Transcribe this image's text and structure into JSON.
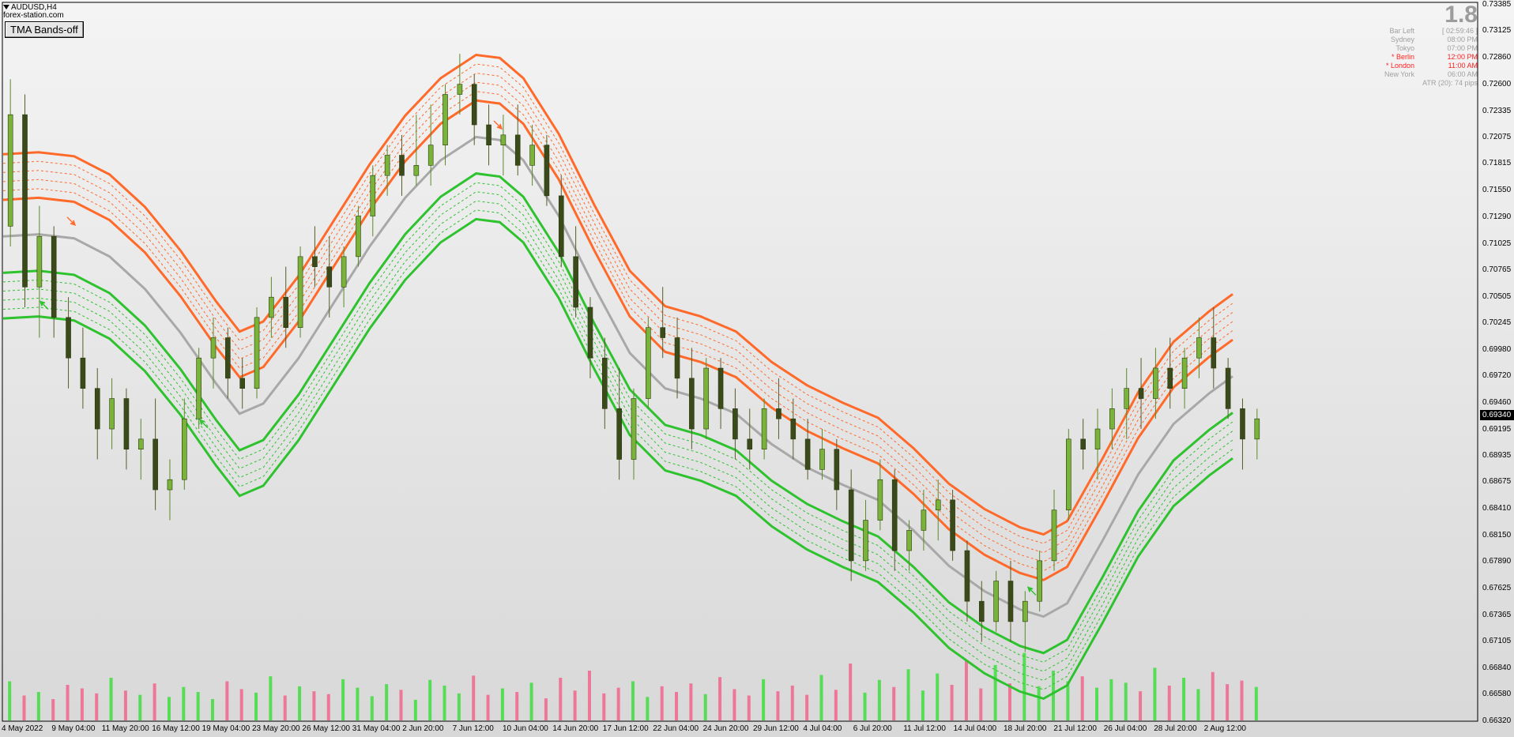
{
  "header": {
    "symbol": "AUDUSD,H4",
    "broker": "forex-station.com",
    "tma_button": "TMA Bands-off"
  },
  "info_panel": {
    "spread": "1.8",
    "rows": [
      {
        "label": "Bar Left",
        "value": "[ 02:59:46 ]",
        "highlight": false
      },
      {
        "label": "Sydney",
        "value": "08:00 PM",
        "highlight": false
      },
      {
        "label": "Tokyo",
        "value": "07:00 PM",
        "highlight": false
      },
      {
        "label": "* Berlin",
        "value": "12:00 PM",
        "highlight": true
      },
      {
        "label": "* London",
        "value": "11:00 AM",
        "highlight": true
      },
      {
        "label": "New York",
        "value": "06:00 AM",
        "highlight": false
      }
    ],
    "atr": "ATR (20): 74 pips"
  },
  "colors": {
    "upper_band": "#ff6a2a",
    "lower_band": "#2ec22e",
    "mid_line": "#a8a8a8",
    "candle_up": "#5a8a2a",
    "candle_down": "#5a5a2a",
    "volume_up": "#55dd55",
    "volume_down": "#ee7799"
  },
  "chart_data": {
    "type": "candlestick",
    "symbol": "AUDUSD",
    "timeframe": "H4",
    "current_price": "0.69340",
    "ylim": [
      0.66325,
      0.734
    ],
    "price_ticks": [
      "0.73385",
      "0.73125",
      "0.72860",
      "0.72600",
      "0.72335",
      "0.72075",
      "0.71815",
      "0.71550",
      "0.71290",
      "0.71025",
      "0.70765",
      "0.70505",
      "0.70245",
      "0.69980",
      "0.69720",
      "0.69460",
      "0.69195",
      "0.68935",
      "0.68675",
      "0.68410",
      "0.68150",
      "0.67890",
      "0.67625",
      "0.67365",
      "0.67105",
      "0.66840",
      "0.66580",
      "0.66320"
    ],
    "date_ticks": [
      "4 May 2022",
      "9 May 04:00",
      "11 May 20:00",
      "16 May 12:00",
      "19 May 04:00",
      "23 May 20:00",
      "26 May 12:00",
      "31 May 04:00",
      "2 Jun 20:00",
      "7 Jun 12:00",
      "10 Jun 04:00",
      "14 Jun 20:00",
      "17 Jun 12:00",
      "22 Jun 04:00",
      "24 Jun 20:00",
      "29 Jun 12:00",
      "4 Jul 04:00",
      "6 Jul 20:00",
      "11 Jul 12:00",
      "14 Jul 04:00",
      "18 Jul 20:00",
      "21 Jul 12:00",
      "26 Jul 04:00",
      "28 Jul 20:00",
      "2 Aug 12:00"
    ],
    "tma_mid": [
      [
        0,
        0.711
      ],
      [
        3,
        0.7112
      ],
      [
        6,
        0.7108
      ],
      [
        9,
        0.709
      ],
      [
        12,
        0.7058
      ],
      [
        15,
        0.7015
      ],
      [
        18,
        0.6965
      ],
      [
        20,
        0.6935
      ],
      [
        22,
        0.6945
      ],
      [
        25,
        0.699
      ],
      [
        28,
        0.7045
      ],
      [
        31,
        0.71
      ],
      [
        34,
        0.7148
      ],
      [
        37,
        0.7185
      ],
      [
        40,
        0.7208
      ],
      [
        42,
        0.7205
      ],
      [
        44,
        0.7185
      ],
      [
        47,
        0.713
      ],
      [
        50,
        0.706
      ],
      [
        53,
        0.6995
      ],
      [
        56,
        0.696
      ],
      [
        59,
        0.695
      ],
      [
        62,
        0.6935
      ],
      [
        65,
        0.6905
      ],
      [
        68,
        0.6882
      ],
      [
        71,
        0.6865
      ],
      [
        74,
        0.685
      ],
      [
        77,
        0.682
      ],
      [
        80,
        0.6785
      ],
      [
        83,
        0.676
      ],
      [
        86,
        0.6742
      ],
      [
        88,
        0.6735
      ],
      [
        90,
        0.6748
      ],
      [
        93,
        0.681
      ],
      [
        96,
        0.6875
      ],
      [
        99,
        0.6925
      ],
      [
        102,
        0.6955
      ],
      [
        104,
        0.6972
      ]
    ],
    "band_offsets": [
      -0.0081,
      -0.0072,
      -0.0063,
      -0.0054,
      -0.0045,
      -0.0036,
      0.0036,
      0.0045,
      0.0054,
      0.0063,
      0.0072,
      0.0081
    ],
    "candles": [
      [
        0.712,
        0.7265,
        0.71,
        0.723
      ],
      [
        0.723,
        0.725,
        0.704,
        0.706
      ],
      [
        0.706,
        0.714,
        0.701,
        0.711
      ],
      [
        0.711,
        0.712,
        0.701,
        0.703
      ],
      [
        0.703,
        0.705,
        0.696,
        0.699
      ],
      [
        0.699,
        0.702,
        0.694,
        0.696
      ],
      [
        0.696,
        0.698,
        0.689,
        0.692
      ],
      [
        0.692,
        0.697,
        0.69,
        0.695
      ],
      [
        0.695,
        0.696,
        0.688,
        0.69
      ],
      [
        0.69,
        0.693,
        0.687,
        0.691
      ],
      [
        0.691,
        0.695,
        0.684,
        0.686
      ],
      [
        0.686,
        0.689,
        0.683,
        0.687
      ],
      [
        0.687,
        0.695,
        0.686,
        0.693
      ],
      [
        0.693,
        0.7,
        0.692,
        0.699
      ],
      [
        0.699,
        0.703,
        0.696,
        0.701
      ],
      [
        0.701,
        0.702,
        0.695,
        0.697
      ],
      [
        0.697,
        0.699,
        0.694,
        0.696
      ],
      [
        0.696,
        0.704,
        0.695,
        0.703
      ],
      [
        0.703,
        0.707,
        0.701,
        0.705
      ],
      [
        0.705,
        0.708,
        0.7,
        0.702
      ],
      [
        0.702,
        0.71,
        0.701,
        0.709
      ],
      [
        0.709,
        0.712,
        0.706,
        0.708
      ],
      [
        0.708,
        0.711,
        0.703,
        0.706
      ],
      [
        0.706,
        0.71,
        0.704,
        0.709
      ],
      [
        0.709,
        0.714,
        0.708,
        0.713
      ],
      [
        0.713,
        0.718,
        0.711,
        0.717
      ],
      [
        0.717,
        0.72,
        0.715,
        0.719
      ],
      [
        0.719,
        0.721,
        0.715,
        0.717
      ],
      [
        0.717,
        0.723,
        0.716,
        0.718
      ],
      [
        0.718,
        0.724,
        0.716,
        0.72
      ],
      [
        0.72,
        0.726,
        0.718,
        0.725
      ],
      [
        0.725,
        0.729,
        0.723,
        0.726
      ],
      [
        0.726,
        0.727,
        0.72,
        0.722
      ],
      [
        0.722,
        0.724,
        0.718,
        0.72
      ],
      [
        0.72,
        0.723,
        0.717,
        0.721
      ],
      [
        0.721,
        0.724,
        0.717,
        0.718
      ],
      [
        0.718,
        0.722,
        0.716,
        0.72
      ],
      [
        0.72,
        0.721,
        0.714,
        0.715
      ],
      [
        0.715,
        0.717,
        0.708,
        0.709
      ],
      [
        0.709,
        0.712,
        0.703,
        0.704
      ],
      [
        0.704,
        0.705,
        0.697,
        0.699
      ],
      [
        0.699,
        0.701,
        0.692,
        0.694
      ],
      [
        0.694,
        0.698,
        0.687,
        0.689
      ],
      [
        0.689,
        0.696,
        0.687,
        0.695
      ],
      [
        0.695,
        0.703,
        0.694,
        0.702
      ],
      [
        0.702,
        0.706,
        0.699,
        0.701
      ],
      [
        0.701,
        0.703,
        0.695,
        0.697
      ],
      [
        0.697,
        0.7,
        0.69,
        0.692
      ],
      [
        0.692,
        0.699,
        0.691,
        0.698
      ],
      [
        0.698,
        0.699,
        0.692,
        0.694
      ],
      [
        0.694,
        0.696,
        0.689,
        0.691
      ],
      [
        0.691,
        0.694,
        0.688,
        0.69
      ],
      [
        0.69,
        0.695,
        0.689,
        0.694
      ],
      [
        0.694,
        0.697,
        0.691,
        0.693
      ],
      [
        0.693,
        0.695,
        0.689,
        0.691
      ],
      [
        0.691,
        0.693,
        0.687,
        0.688
      ],
      [
        0.688,
        0.692,
        0.687,
        0.69
      ],
      [
        0.69,
        0.691,
        0.684,
        0.686
      ],
      [
        0.686,
        0.688,
        0.677,
        0.679
      ],
      [
        0.679,
        0.685,
        0.678,
        0.683
      ],
      [
        0.683,
        0.689,
        0.682,
        0.687
      ],
      [
        0.687,
        0.688,
        0.678,
        0.68
      ],
      [
        0.68,
        0.683,
        0.678,
        0.682
      ],
      [
        0.682,
        0.686,
        0.68,
        0.684
      ],
      [
        0.684,
        0.687,
        0.681,
        0.685
      ],
      [
        0.685,
        0.686,
        0.679,
        0.68
      ],
      [
        0.68,
        0.681,
        0.673,
        0.675
      ],
      [
        0.675,
        0.677,
        0.671,
        0.673
      ],
      [
        0.673,
        0.678,
        0.672,
        0.677
      ],
      [
        0.677,
        0.679,
        0.671,
        0.673
      ],
      [
        0.673,
        0.676,
        0.67,
        0.675
      ],
      [
        0.675,
        0.68,
        0.674,
        0.679
      ],
      [
        0.679,
        0.686,
        0.678,
        0.684
      ],
      [
        0.684,
        0.692,
        0.683,
        0.691
      ],
      [
        0.691,
        0.693,
        0.688,
        0.69
      ],
      [
        0.69,
        0.694,
        0.687,
        0.692
      ],
      [
        0.692,
        0.696,
        0.69,
        0.694
      ],
      [
        0.694,
        0.698,
        0.691,
        0.696
      ],
      [
        0.696,
        0.699,
        0.692,
        0.695
      ],
      [
        0.695,
        0.7,
        0.693,
        0.698
      ],
      [
        0.698,
        0.701,
        0.694,
        0.696
      ],
      [
        0.696,
        0.7,
        0.694,
        0.699
      ],
      [
        0.699,
        0.703,
        0.697,
        0.701
      ],
      [
        0.701,
        0.704,
        0.696,
        0.698
      ],
      [
        0.698,
        0.699,
        0.693,
        0.694
      ],
      [
        0.694,
        0.695,
        0.688,
        0.691
      ],
      [
        0.691,
        0.694,
        0.689,
        0.693
      ]
    ],
    "volumes": [
      0.55,
      0.35,
      0.4,
      0.3,
      0.5,
      0.45,
      0.38,
      0.6,
      0.42,
      0.36,
      0.52,
      0.33,
      0.47,
      0.4,
      0.3,
      0.55,
      0.44,
      0.39,
      0.62,
      0.35,
      0.48,
      0.41,
      0.37,
      0.58,
      0.46,
      0.34,
      0.51,
      0.43,
      0.29,
      0.57,
      0.49,
      0.38,
      0.63,
      0.36,
      0.45,
      0.4,
      0.53,
      0.31,
      0.6,
      0.42,
      0.7,
      0.38,
      0.46,
      0.55,
      0.33,
      0.48,
      0.4,
      0.52,
      0.37,
      0.61,
      0.44,
      0.35,
      0.58,
      0.41,
      0.49,
      0.36,
      0.64,
      0.43,
      0.8,
      0.39,
      0.57,
      0.47,
      0.72,
      0.42,
      0.66,
      0.5,
      0.85,
      0.45,
      0.78,
      0.52,
      0.95,
      0.48,
      0.7,
      0.55,
      0.62,
      0.46,
      0.58,
      0.53,
      0.41,
      0.74,
      0.49,
      0.6,
      0.44,
      0.68,
      0.51,
      0.56,
      0.47
    ]
  }
}
